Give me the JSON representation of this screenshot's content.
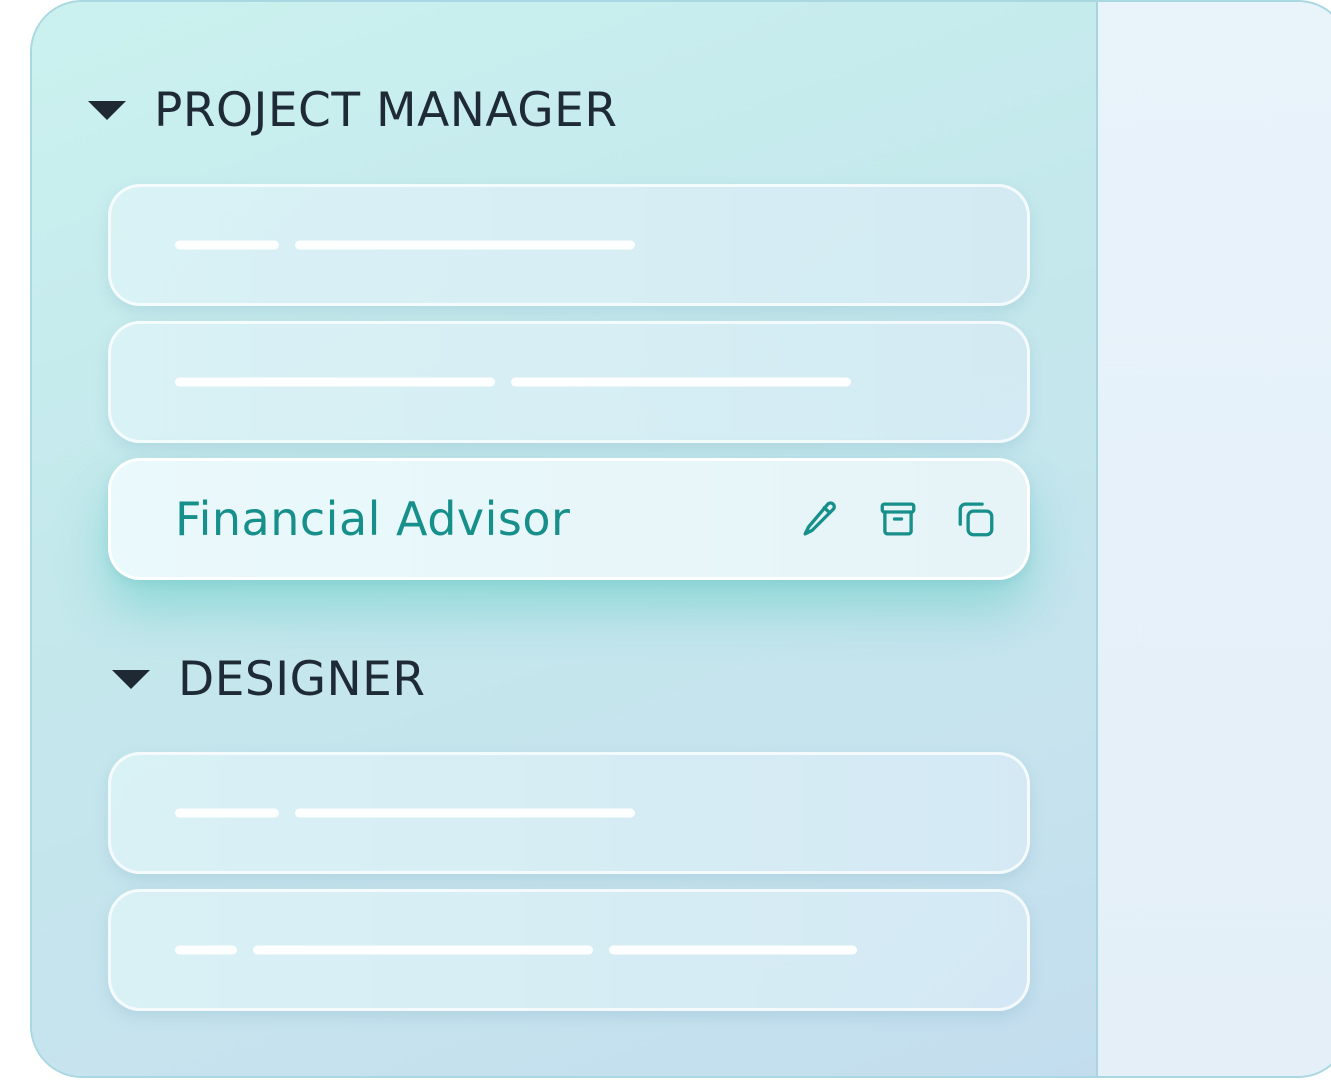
{
  "groups": [
    {
      "title": "PROJECT MANAGER",
      "items": [
        {
          "placeholder_lines": [
            0.11,
            0.37
          ]
        },
        {
          "placeholder_lines": [
            0.35,
            0.37
          ]
        },
        {
          "label": "Financial Advisor",
          "active": true,
          "actions": [
            "edit-icon",
            "archive-icon",
            "duplicate-icon"
          ]
        }
      ]
    },
    {
      "title": "DESIGNER",
      "items": [
        {
          "placeholder_lines": [
            0.11,
            0.37
          ]
        },
        {
          "placeholder_lines": [
            0.07,
            0.37,
            0.27
          ]
        }
      ]
    }
  ],
  "colors": {
    "accent": "#178f8a",
    "heading": "#1e2a36",
    "frame_border": "#a9d7e2"
  }
}
